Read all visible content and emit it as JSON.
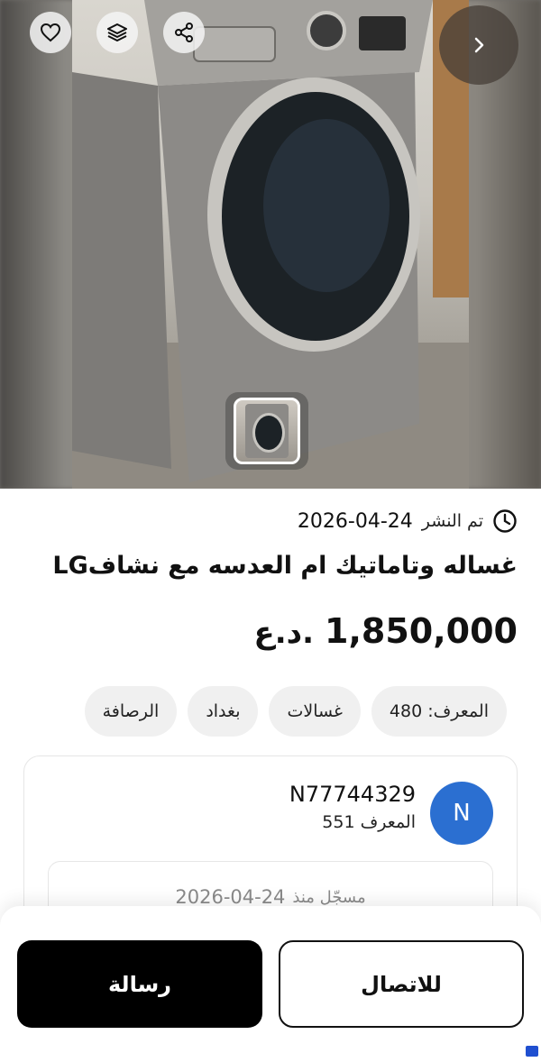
{
  "listing": {
    "posted_label": "تم النشر",
    "posted_date": "2026-04-24",
    "title": "غساله  وتاماتيك ام العدسه مع نشافLG",
    "price_value": "1,850,000",
    "price_currency": "د.ع.",
    "chips": [
      {
        "label": "المعرف: 480"
      },
      {
        "label": "غسالات"
      },
      {
        "label": "بغداد"
      },
      {
        "label": "الرصافة"
      }
    ]
  },
  "seller": {
    "avatar_letter": "N",
    "name": "N77744329",
    "id_label": "المعرف 551",
    "member_label": "مسجّل منذ",
    "member_date": "2026-04-24"
  },
  "actions": {
    "call_label": "للاتصال",
    "message_label": "رسالة"
  },
  "colors": {
    "avatar": "#2b6fd1",
    "primary_button": "#000000"
  },
  "icons": {
    "favorite": "heart-icon",
    "layers": "layers-icon",
    "share": "share-icon",
    "next": "chevron-right-icon",
    "clock": "clock-icon"
  }
}
